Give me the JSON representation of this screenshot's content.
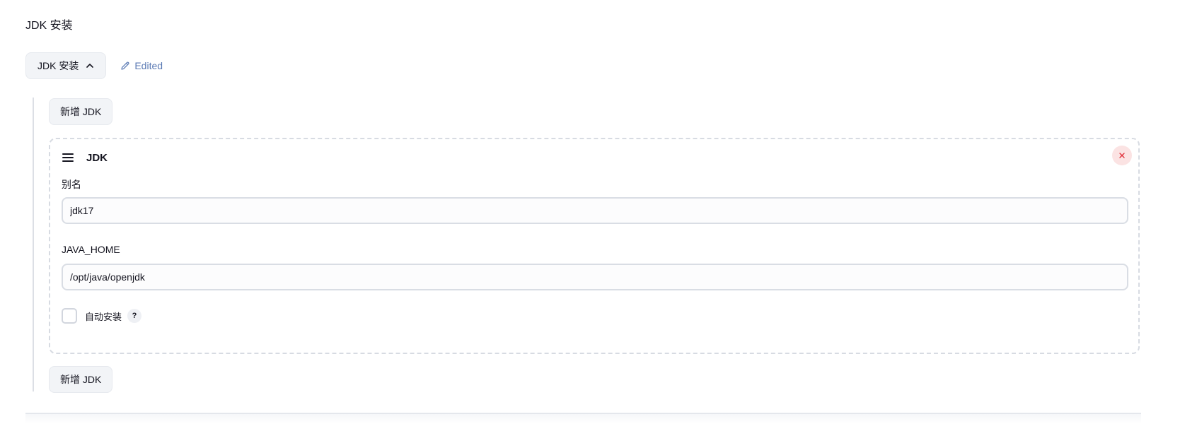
{
  "section": {
    "title": "JDK 安装",
    "toggle_label": "JDK 安装",
    "edited_label": "Edited"
  },
  "repeatable": {
    "add_top_label": "新增 JDK",
    "add_bottom_label": "新增 JDK"
  },
  "jdk_item": {
    "title": "JDK",
    "alias_label": "别名",
    "alias_value": "jdk17",
    "java_home_label": "JAVA_HOME",
    "java_home_value": "/opt/java/openjdk",
    "auto_install_label": "自动安装",
    "auto_install_checked": false,
    "help_text": "?"
  },
  "icons": {
    "collapse": "chevron-up-icon",
    "edited": "pencil-icon",
    "drag": "drag-handle-icon",
    "delete": "close-icon",
    "help": "help-icon"
  },
  "colors": {
    "edited_text": "#5b7ab4",
    "delete_icon": "#e0303a",
    "delete_bg": "#fbe3e3"
  }
}
